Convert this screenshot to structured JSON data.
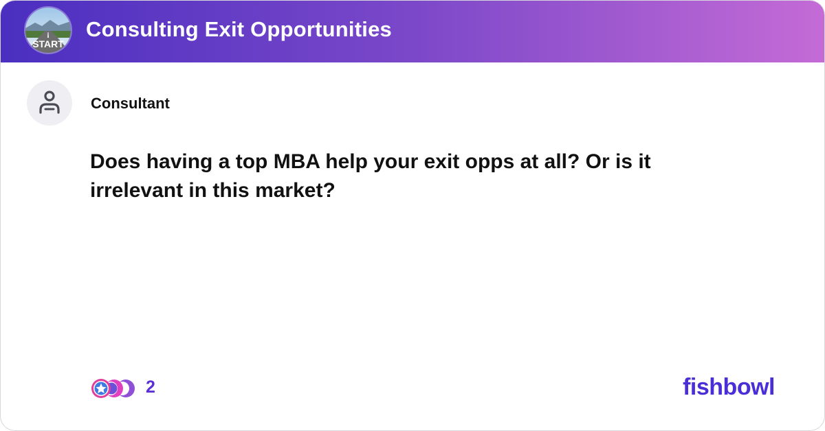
{
  "bowl": {
    "title": "Consulting Exit Opportunities",
    "avatar_icon": "road-start-image",
    "avatar_text": "START"
  },
  "post": {
    "author": "Consultant",
    "author_icon": "person-icon",
    "text": "Does having a top MBA help your exit opps at all?  Or is it irrelevant in this market?"
  },
  "reactions": {
    "icons": [
      "star-reaction-icon",
      "moon-reaction-icon",
      "moon-reaction-icon"
    ],
    "count": "2"
  },
  "brand": {
    "name": "fishbowl",
    "color": "#4b2fd6"
  },
  "colors": {
    "header_start": "#4a2fc0",
    "header_end": "#c46bd6",
    "accent": "#5a2fd8"
  }
}
